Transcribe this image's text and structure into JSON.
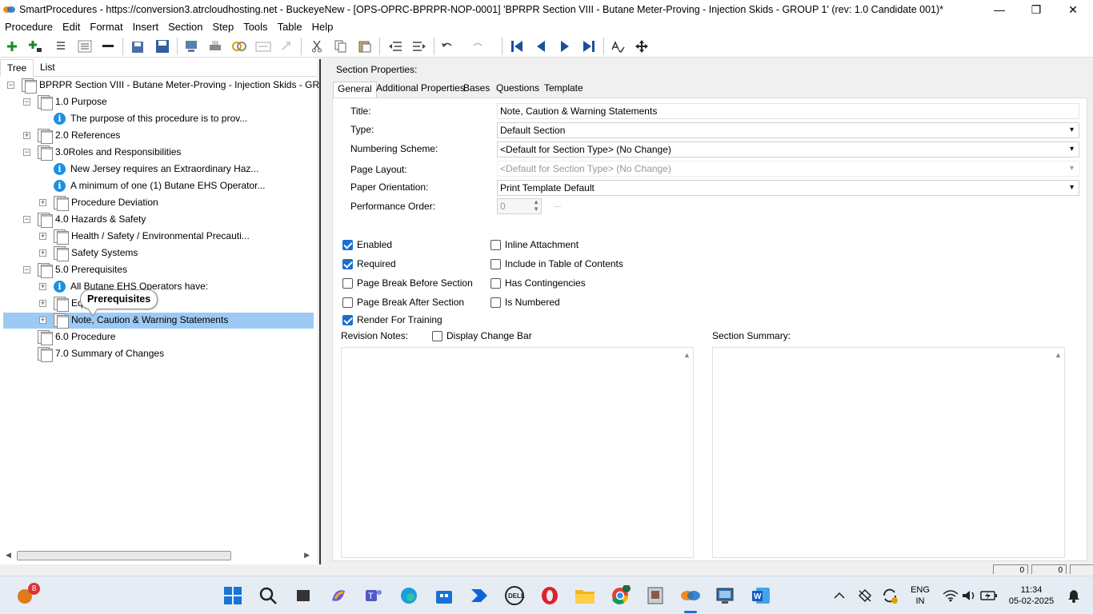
{
  "window": {
    "title": "SmartProcedures - https://conversion3.atrcloudhosting.net - BuckeyeNew - [OPS-OPRC-BPRPR-NOP-0001] 'BPRPR Section VIII - Butane Meter-Proving - Injection Skids - GROUP 1' (rev: 1.0 Candidate 001)*",
    "minimize": "—",
    "restore": "❐",
    "close": "✕"
  },
  "menu": [
    "Procedure",
    "Edit",
    "Format",
    "Insert",
    "Section",
    "Step",
    "Tools",
    "Table",
    "Help"
  ],
  "toolbar_icons": [
    "add-icon",
    "add-child-icon",
    "list-icon",
    "list-alt-icon",
    "remove-icon",
    "save-all-icon",
    "save-icon",
    "export-icon",
    "print-icon",
    "link-icon",
    "attach-icon",
    "redo-disabled-icon",
    "cut-icon",
    "copy-icon",
    "paste-icon",
    "outdent-icon",
    "indent-icon",
    "undo-icon",
    "redo-icon",
    "first-icon",
    "prev-icon",
    "next-icon",
    "last-icon",
    "spellcheck-icon",
    "move-icon"
  ],
  "left": {
    "tabs": [
      "Tree",
      "List"
    ],
    "tree": [
      {
        "label": "BPRPR Section VIII - Butane Meter-Proving - Injection Skids - GR...",
        "icon": "doc",
        "level": 0,
        "exp": "−"
      },
      {
        "label": "1.0 Purpose",
        "icon": "doc",
        "level": 1,
        "exp": "−"
      },
      {
        "label": "The purpose of this procedure is to prov...",
        "icon": "info",
        "level": 2,
        "exp": ""
      },
      {
        "label": "2.0 References",
        "icon": "doc",
        "level": 1,
        "exp": "+"
      },
      {
        "label": "3.0Roles and Responsibilities",
        "icon": "doc",
        "level": 1,
        "exp": "−"
      },
      {
        "label": "New Jersey requires an Extraordinary Haz...",
        "icon": "info",
        "level": 2,
        "exp": ""
      },
      {
        "label": "A minimum of one (1) Butane EHS Operator...",
        "icon": "info",
        "level": 2,
        "exp": ""
      },
      {
        "label": "Procedure Deviation",
        "icon": "doc",
        "level": 2,
        "exp": "+"
      },
      {
        "label": "4.0 Hazards & Safety",
        "icon": "doc",
        "level": 1,
        "exp": "−"
      },
      {
        "label": "Health / Safety / Environmental Precauti...",
        "icon": "doc",
        "level": 2,
        "exp": "+"
      },
      {
        "label": "Safety Systems",
        "icon": "doc",
        "level": 2,
        "exp": "+"
      },
      {
        "label": "5.0 Prerequisites",
        "icon": "doc",
        "level": 1,
        "exp": "−"
      },
      {
        "label": "All Butane EHS Operators have:",
        "icon": "info",
        "level": 2,
        "exp": "+"
      },
      {
        "label": "Eq",
        "icon": "doc",
        "level": 2,
        "exp": "+"
      },
      {
        "label": "Note, Caution & Warning Statements",
        "icon": "doc",
        "level": 2,
        "exp": "+"
      },
      {
        "label": "6.0 Procedure",
        "icon": "doc",
        "level": 1,
        "exp": ""
      },
      {
        "label": "7.0 Summary of Changes",
        "icon": "doc",
        "level": 1,
        "exp": ""
      }
    ],
    "tooltip": "Prerequisites"
  },
  "right": {
    "header": "Section Properties:",
    "tabs": [
      "General",
      "Additional Properties",
      "Bases",
      "Questions",
      "Template"
    ],
    "fields": {
      "title_label": "Title:",
      "title_value": "Note, Caution & Warning Statements",
      "type_label": "Type:",
      "type_value": "Default Section",
      "numbering_label": "Numbering Scheme:",
      "numbering_value": "<Default for Section Type> (No Change)",
      "layout_label": "Page Layout:",
      "layout_value": "<Default for Section Type> (No Change)",
      "orientation_label": "Paper Orientation:",
      "orientation_value": "Print Template Default",
      "perf_label": "Performance Order:",
      "perf_value": "0",
      "perf_button": "..."
    },
    "checks": {
      "enabled": "Enabled",
      "required": "Required",
      "pb_before": "Page Break Before Section",
      "pb_after": "Page Break After Section",
      "render_training": "Render For Training",
      "inline_attachment": "Inline Attachment",
      "include_toc": "Include in Table of Contents",
      "has_contingencies": "Has Contingencies",
      "is_numbered": "Is Numbered",
      "display_change_bar": "Display Change Bar"
    },
    "revision_notes_label": "Revision Notes:",
    "section_summary_label": "Section Summary:"
  },
  "status": {
    "box1": "0",
    "box2": "0"
  },
  "taskbar": {
    "weather_badge": "8",
    "lang": "ENG",
    "region": "IN",
    "time": "11:34",
    "date": "05-02-2025"
  }
}
